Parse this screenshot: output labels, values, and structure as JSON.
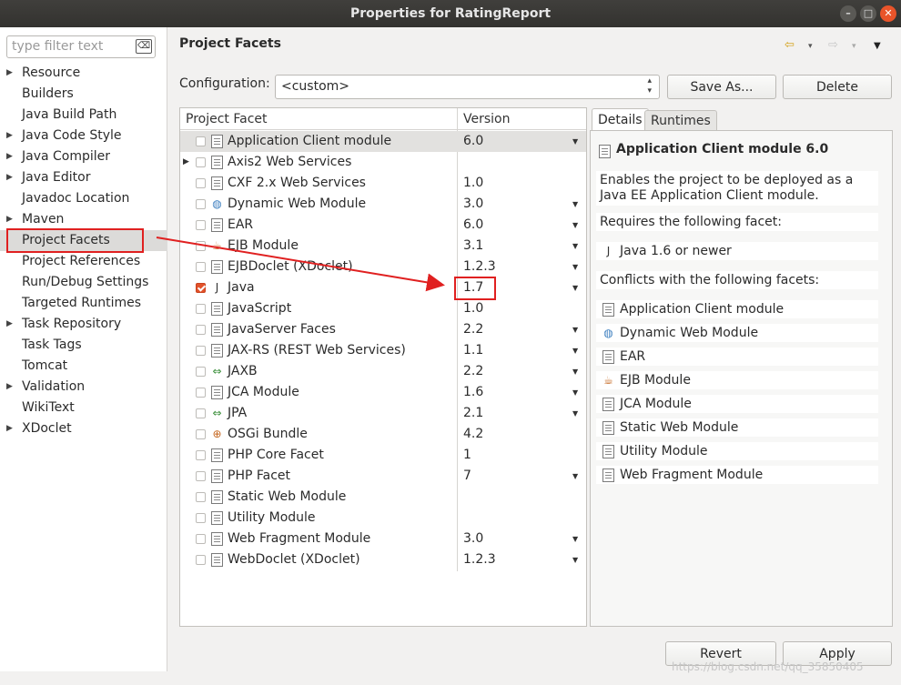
{
  "window": {
    "title": "Properties for RatingReport",
    "minimize_glyph": "–",
    "maximize_glyph": "□",
    "close_glyph": "✕"
  },
  "filter": {
    "placeholder": "type filter text",
    "clear_glyph": "⌫"
  },
  "nav": {
    "items": [
      {
        "label": "Resource",
        "expandable": true
      },
      {
        "label": "Builders",
        "expandable": false
      },
      {
        "label": "Java Build Path",
        "expandable": false
      },
      {
        "label": "Java Code Style",
        "expandable": true
      },
      {
        "label": "Java Compiler",
        "expandable": true
      },
      {
        "label": "Java Editor",
        "expandable": true
      },
      {
        "label": "Javadoc Location",
        "expandable": false
      },
      {
        "label": "Maven",
        "expandable": true
      },
      {
        "label": "Project Facets",
        "expandable": false,
        "selected": true
      },
      {
        "label": "Project References",
        "expandable": false
      },
      {
        "label": "Run/Debug Settings",
        "expandable": false
      },
      {
        "label": "Targeted Runtimes",
        "expandable": false
      },
      {
        "label": "Task Repository",
        "expandable": true
      },
      {
        "label": "Task Tags",
        "expandable": false
      },
      {
        "label": "Tomcat",
        "expandable": false
      },
      {
        "label": "Validation",
        "expandable": true
      },
      {
        "label": "WikiText",
        "expandable": false
      },
      {
        "label": "XDoclet",
        "expandable": true
      }
    ]
  },
  "page": {
    "title": "Project Facets",
    "nav_back_glyph": "⇦",
    "nav_forward_glyph": "⇨",
    "menu_glyph": "▾",
    "menu_glyph2": "▼"
  },
  "config": {
    "label": "Configuration:",
    "value": "<custom>",
    "save_as": "Save As...",
    "delete": "Delete"
  },
  "table": {
    "col_facet": "Project Facet",
    "col_version": "Version",
    "rows": [
      {
        "name": "Application Client module",
        "version": "6.0",
        "checked": false,
        "dropdown": true,
        "icon": "doc",
        "selected": true
      },
      {
        "name": "Axis2 Web Services",
        "version": "",
        "checked": false,
        "dropdown": false,
        "icon": "doc",
        "expandable": true
      },
      {
        "name": "CXF 2.x Web Services",
        "version": "1.0",
        "checked": false,
        "dropdown": false,
        "icon": "doc"
      },
      {
        "name": "Dynamic Web Module",
        "version": "3.0",
        "checked": false,
        "dropdown": true,
        "icon": "globe"
      },
      {
        "name": "EAR",
        "version": "6.0",
        "checked": false,
        "dropdown": true,
        "icon": "doc"
      },
      {
        "name": "EJB Module",
        "version": "3.1",
        "checked": false,
        "dropdown": true,
        "icon": "bean"
      },
      {
        "name": "EJBDoclet (XDoclet)",
        "version": "1.2.3",
        "checked": false,
        "dropdown": true,
        "icon": "doc"
      },
      {
        "name": "Java",
        "version": "1.7",
        "checked": true,
        "dropdown": true,
        "icon": "java"
      },
      {
        "name": "JavaScript",
        "version": "1.0",
        "checked": false,
        "dropdown": false,
        "icon": "doc"
      },
      {
        "name": "JavaServer Faces",
        "version": "2.2",
        "checked": false,
        "dropdown": true,
        "icon": "doc"
      },
      {
        "name": "JAX-RS (REST Web Services)",
        "version": "1.1",
        "checked": false,
        "dropdown": true,
        "icon": "doc"
      },
      {
        "name": "JAXB",
        "version": "2.2",
        "checked": false,
        "dropdown": true,
        "icon": "arrows"
      },
      {
        "name": "JCA Module",
        "version": "1.6",
        "checked": false,
        "dropdown": true,
        "icon": "doc"
      },
      {
        "name": "JPA",
        "version": "2.1",
        "checked": false,
        "dropdown": true,
        "icon": "arrows"
      },
      {
        "name": "OSGi Bundle",
        "version": "4.2",
        "checked": false,
        "dropdown": false,
        "icon": "osgi"
      },
      {
        "name": "PHP Core Facet",
        "version": "1",
        "checked": false,
        "dropdown": false,
        "icon": "doc"
      },
      {
        "name": "PHP Facet",
        "version": "7",
        "checked": false,
        "dropdown": true,
        "icon": "doc"
      },
      {
        "name": "Static Web Module",
        "version": "",
        "checked": false,
        "dropdown": false,
        "icon": "doc"
      },
      {
        "name": "Utility Module",
        "version": "",
        "checked": false,
        "dropdown": false,
        "icon": "doc"
      },
      {
        "name": "Web Fragment Module",
        "version": "3.0",
        "checked": false,
        "dropdown": true,
        "icon": "doc"
      },
      {
        "name": "WebDoclet (XDoclet)",
        "version": "1.2.3",
        "checked": false,
        "dropdown": true,
        "icon": "doc"
      }
    ]
  },
  "details": {
    "tab_details": "Details",
    "tab_runtimes": "Runtimes",
    "heading": "Application Client module 6.0",
    "description": "Enables the project to be deployed as a Java EE Application Client module.",
    "requires_label": "Requires the following facet:",
    "requires": [
      {
        "name": "Java 1.6 or newer",
        "icon": "java"
      }
    ],
    "conflicts_label": "Conflicts with the following facets:",
    "conflicts": [
      {
        "name": "Application Client module",
        "icon": "doc"
      },
      {
        "name": "Dynamic Web Module",
        "icon": "globe"
      },
      {
        "name": "EAR",
        "icon": "doc"
      },
      {
        "name": "EJB Module",
        "icon": "bean"
      },
      {
        "name": "JCA Module",
        "icon": "doc"
      },
      {
        "name": "Static Web Module",
        "icon": "doc"
      },
      {
        "name": "Utility Module",
        "icon": "doc"
      },
      {
        "name": "Web Fragment Module",
        "icon": "doc"
      }
    ]
  },
  "buttons": {
    "revert": "Revert",
    "apply": "Apply"
  },
  "watermark": "https://blog.csdn.net/qq_35850405",
  "colors": {
    "annotation": "#e02020",
    "checkbox_checked": "#e2522a",
    "selection": "#dcdbd9"
  }
}
